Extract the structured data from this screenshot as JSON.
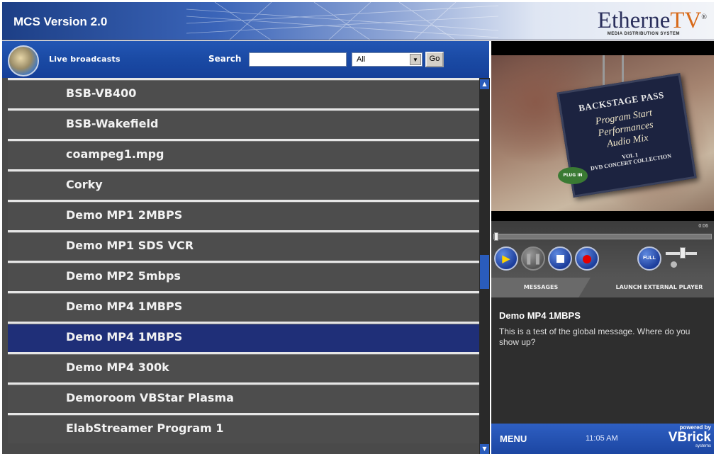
{
  "header": {
    "title": "MCS Version 2.0",
    "logo": {
      "name_main": "Etherne",
      "name_accent": "TV",
      "mark": "®",
      "subtitle": "MEDIA DISTRIBUTION SYSTEM"
    }
  },
  "toolbar": {
    "section_label": "Live broadcasts",
    "search_label": "Search",
    "search_value": "",
    "filter_value": "All",
    "go_label": "Go"
  },
  "channels": [
    {
      "label": "BSB-VB400",
      "selected": false
    },
    {
      "label": "BSB-Wakefield",
      "selected": false
    },
    {
      "label": "coampeg1.mpg",
      "selected": false
    },
    {
      "label": "Corky",
      "selected": false
    },
    {
      "label": "Demo MP1 2MBPS",
      "selected": false
    },
    {
      "label": "Demo MP1 SDS VCR",
      "selected": false
    },
    {
      "label": "Demo MP2 5mbps",
      "selected": false
    },
    {
      "label": "Demo MP4 1MBPS",
      "selected": false
    },
    {
      "label": "Demo MP4 1MBPS",
      "selected": true
    },
    {
      "label": "Demo MP4 300k",
      "selected": false
    },
    {
      "label": "Demoroom VBStar Plasma",
      "selected": false
    },
    {
      "label": "ElabStreamer Program 1",
      "selected": false
    }
  ],
  "player": {
    "video_pass": {
      "line1": "BACKSTAGE PASS",
      "line2": "Program Start",
      "line3": "Performances",
      "line4": "Audio Mix",
      "line5": "VOL 1",
      "line6": "DVD CONCERT COLLECTION",
      "sticker": "PLUG IN"
    },
    "time": "0:06",
    "full_label": "FULL",
    "tabs": {
      "messages": "MESSAGES",
      "launch": "LAUNCH EXTERNAL PLAYER"
    },
    "message": {
      "title": "Demo MP4 1MBPS",
      "body": "This is a test of the global message. Where do you show up?"
    }
  },
  "footer": {
    "menu": "MENU",
    "clock": "11:05 AM",
    "brand_top": "powered by",
    "brand_name": "VBrick",
    "brand_sub": "systems"
  },
  "colors": {
    "header_blue": "#1d3f86",
    "toolbar_blue": "#1a4aa4",
    "row_gray": "#4d4d4d",
    "row_selected": "#1f2f78",
    "accent_orange": "#d86a1a"
  }
}
